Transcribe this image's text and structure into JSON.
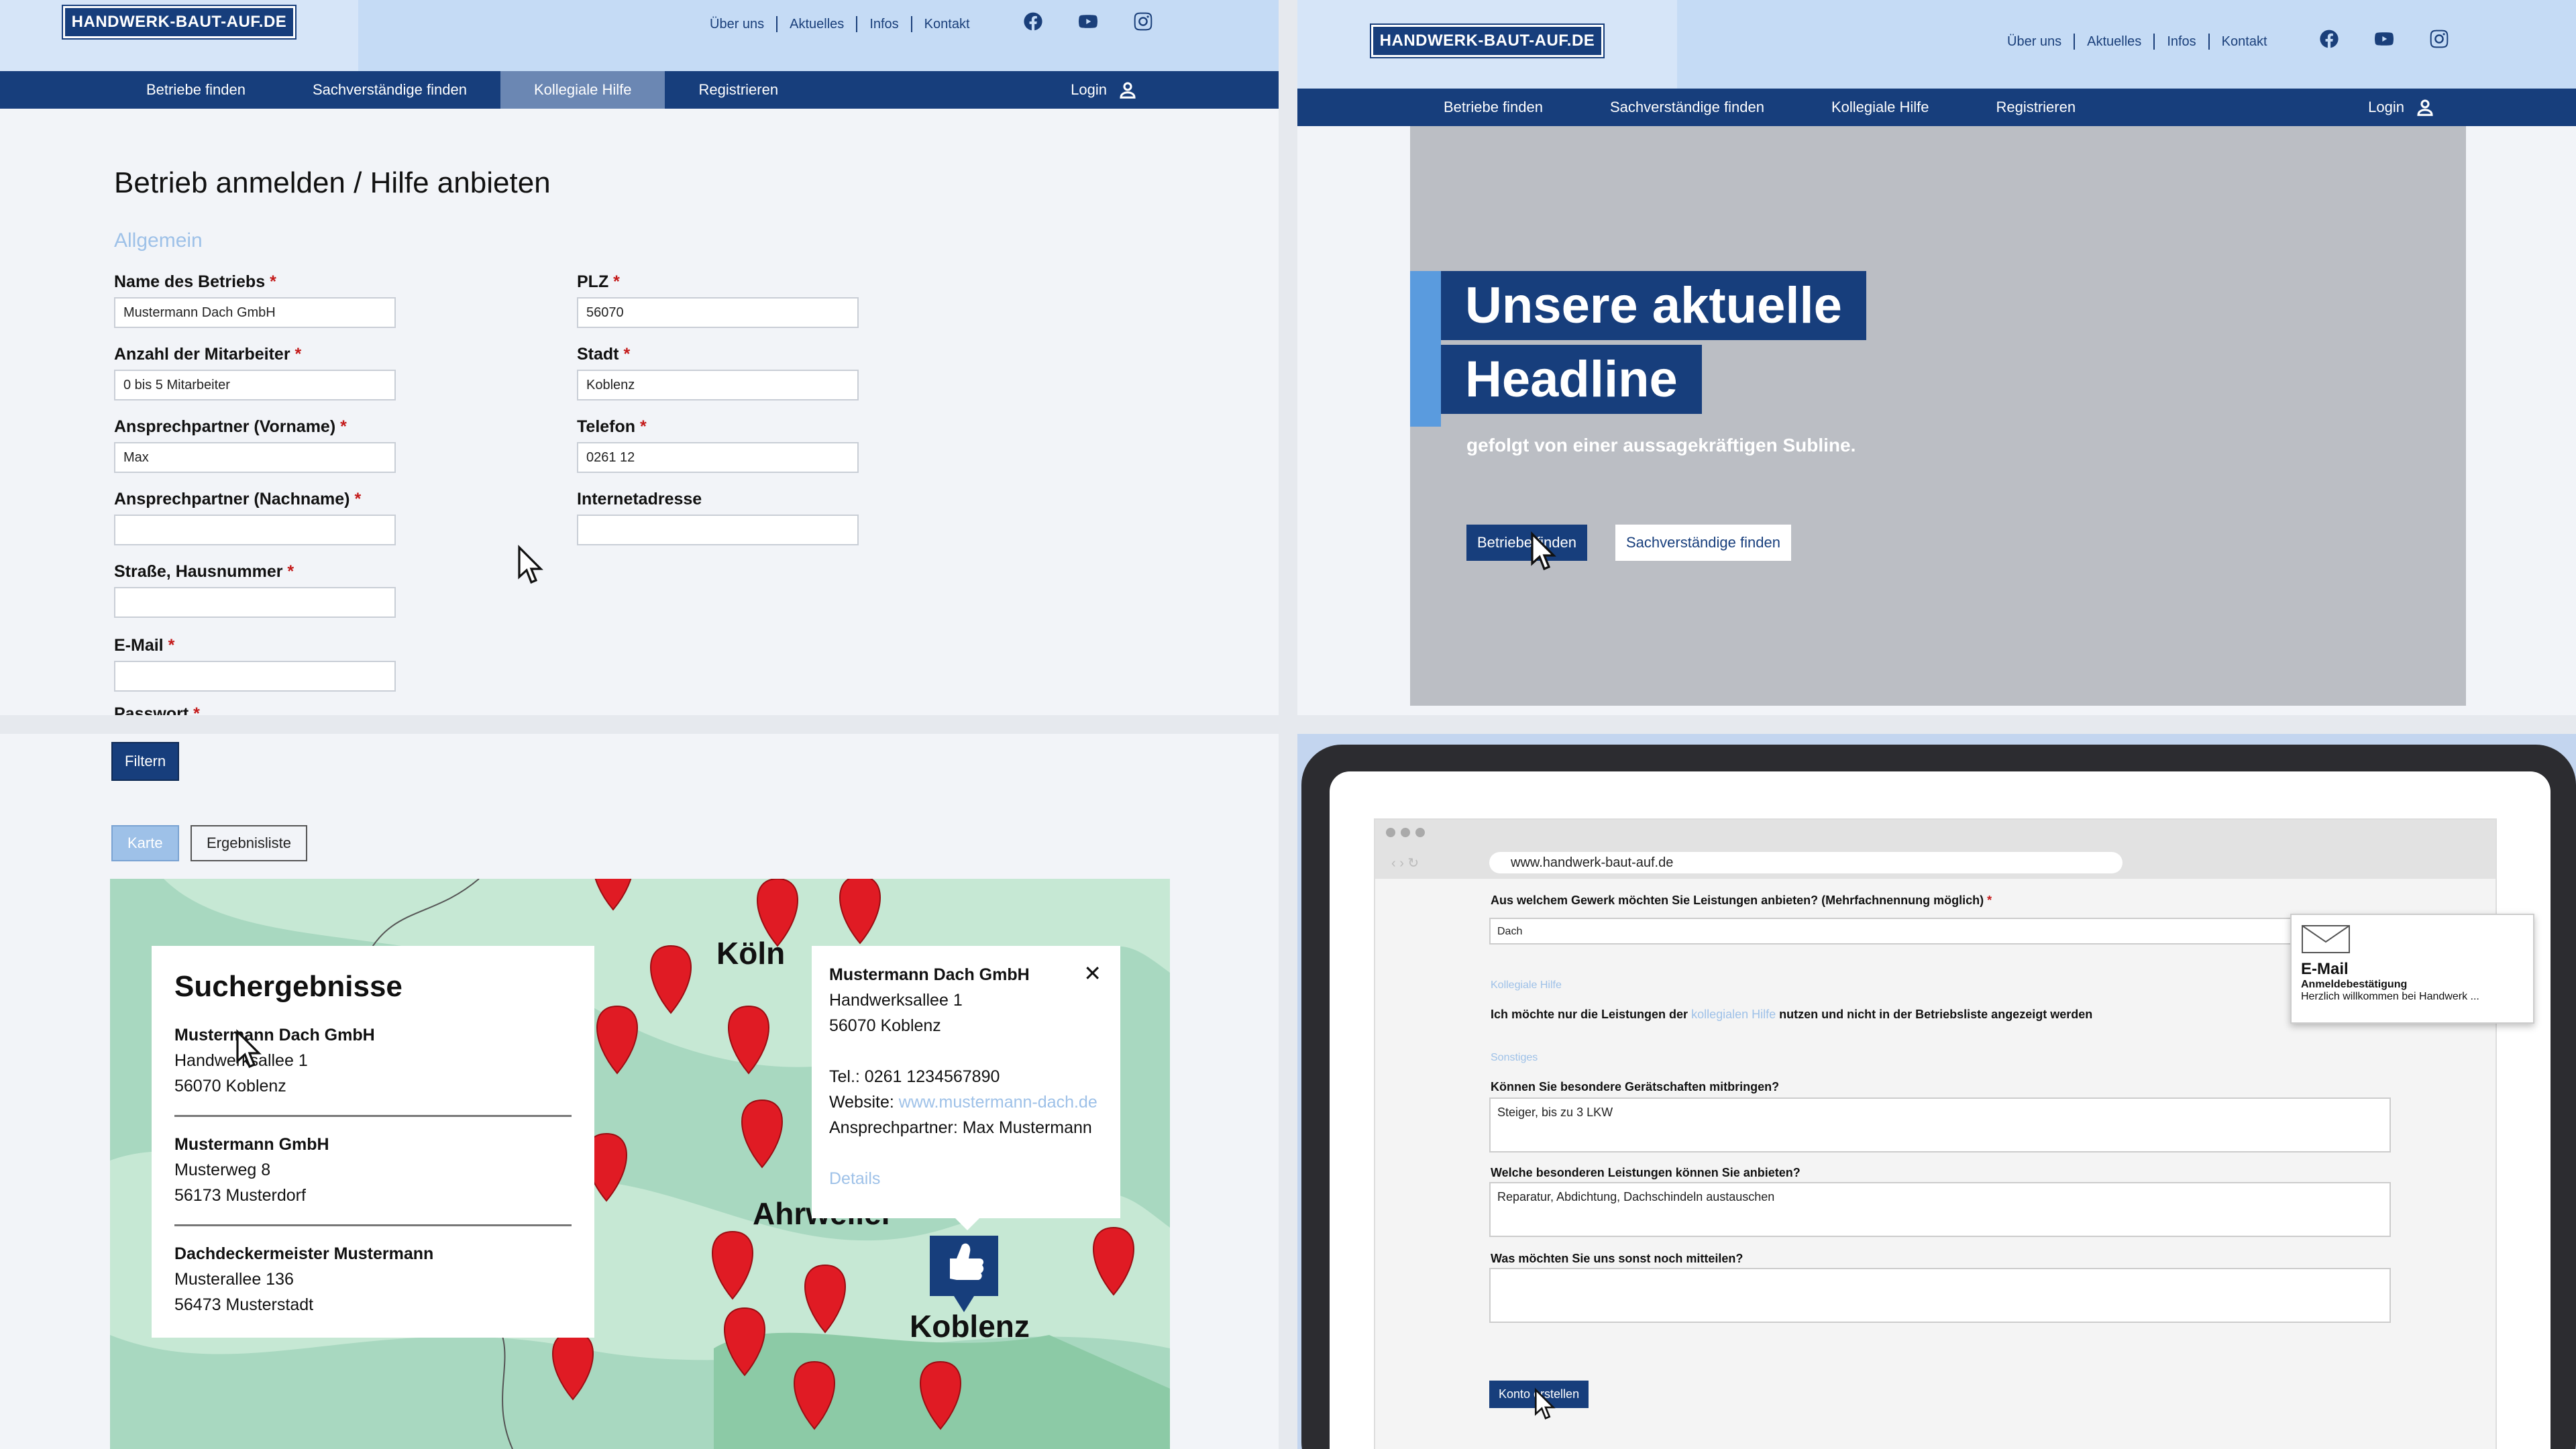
{
  "brand": {
    "logo": "HANDWERK-BAUT-AUF.DE"
  },
  "toplinks": [
    "Über uns",
    "Aktuelles",
    "Infos",
    "Kontakt"
  ],
  "nav": {
    "items": [
      "Betriebe finden",
      "Sachverständige finden",
      "Kollegiale Hilfe",
      "Registrieren"
    ],
    "login": "Login"
  },
  "form": {
    "title": "Betrieb anmelden / Hilfe anbieten",
    "section": "Allgemein",
    "required_mark": "*",
    "fields": [
      {
        "label": "Name des Betriebs",
        "value": "Mustermann Dach GmbH",
        "required": true
      },
      {
        "label": "Anzahl der Mitarbeiter",
        "value": "0 bis 5 Mitarbeiter",
        "required": true
      },
      {
        "label": "Ansprechpartner (Vorname)",
        "value": "Max",
        "required": true
      },
      {
        "label": "Ansprechpartner (Nachname)",
        "value": "",
        "required": true
      },
      {
        "label": "Straße, Hausnummer",
        "value": "",
        "required": true
      },
      {
        "label": "E-Mail",
        "value": "",
        "required": true
      },
      {
        "label": "Passwort",
        "value": "",
        "required": true
      },
      {
        "label": "PLZ",
        "value": "56070",
        "required": true
      },
      {
        "label": "Stadt",
        "value": "Koblenz",
        "required": true
      },
      {
        "label": "Telefon",
        "value": "0261 12",
        "required": true
      },
      {
        "label": "Internetadresse",
        "value": "",
        "required": false
      }
    ]
  },
  "hero": {
    "headline_1": "Unsere aktuelle",
    "headline_2": "Headline",
    "subline": "gefolgt von einer aussagekräftigen Subline.",
    "btn_primary": "Betriebe finden",
    "btn_secondary": "Sachverständige finden"
  },
  "map": {
    "filter": "Filtern",
    "tab_map": "Karte",
    "tab_list": "Ergebnisliste",
    "results_title": "Suchergebnisse",
    "results": [
      {
        "name": "Mustermann Dach GmbH",
        "street": "Handwerksallee 1",
        "city": "56070 Koblenz"
      },
      {
        "name": "Mustermann GmbH",
        "street": "Musterweg 8",
        "city": "56173 Musterdorf"
      },
      {
        "name": "Dachdeckermeister Mustermann",
        "street": "Musterallee 136",
        "city": "56473 Musterstadt"
      }
    ],
    "popup": {
      "name": "Mustermann Dach GmbH",
      "street": "Handwerksallee 1",
      "city": "56070 Koblenz",
      "tel": "Tel.: 0261 1234567890",
      "website_label": "Website:",
      "website": "www.mustermann-dach.de",
      "contact": "Ansprechpartner: Max Mustermann",
      "details": "Details",
      "close": "✕"
    },
    "cities": {
      "koeln": "Köln",
      "ahr": "Ahrweiler",
      "koblenz": "Koblenz"
    }
  },
  "device": {
    "url": "www.handwerk-baut-auf.de",
    "q_gewerk": "Aus welchem Gewerk möchten Sie Leistungen anbieten? (Mehrfachnennung möglich)",
    "gewerk_value": "Dach",
    "sec_hilfe": "Kollegiale Hilfe",
    "hilfe_pre": "Ich möchte nur die Leistungen der",
    "hilfe_link": "kollegialen Hilfe",
    "hilfe_post": "nutzen und nicht in der Betriebsliste angezeigt werden",
    "sec_sonstiges": "Sonstiges",
    "q_geraet": "Können Sie besondere Gerätschaften mitbringen?",
    "geraet_value": "Steiger, bis zu 3 LKW",
    "q_leistungen": "Welche besonderen Leistungen können Sie anbieten?",
    "leistungen_value": "Reparatur, Abdichtung, Dachschindeln austauschen",
    "q_sonst": "Was möchten Sie uns sonst noch mitteilen?",
    "btn_konto": "Konto erstellen",
    "notify": {
      "title": "E-Mail",
      "subject": "Anmeldebestätigung",
      "body": "Herzlich willkommen bei Handwerk ..."
    }
  },
  "colors": {
    "brand": "#173e7c",
    "header": "#c5dbf5",
    "pin": "#e01b24",
    "link": "#9ec1e8",
    "required": "#c41a1a"
  }
}
